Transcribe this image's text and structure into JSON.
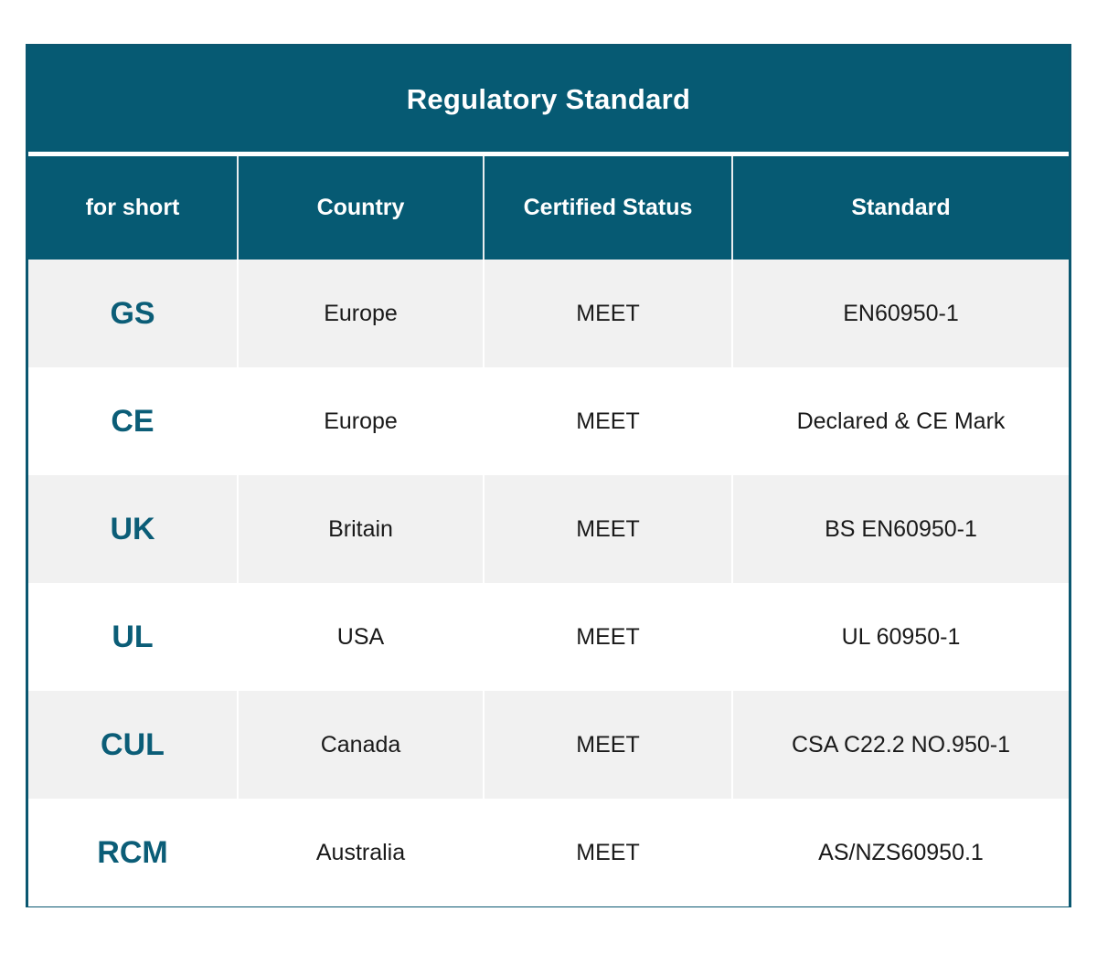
{
  "table": {
    "title": "Regulatory Standard",
    "columns": [
      {
        "key": "abbr",
        "label": "for short"
      },
      {
        "key": "country",
        "label": "Country"
      },
      {
        "key": "status",
        "label": "Certified Status"
      },
      {
        "key": "standard",
        "label": "Standard"
      }
    ],
    "rows": [
      {
        "abbr": "GS",
        "country": "Europe",
        "status": "MEET",
        "standard": "EN60950-1"
      },
      {
        "abbr": "CE",
        "country": "Europe",
        "status": "MEET",
        "standard": "Declared & CE Mark"
      },
      {
        "abbr": "UK",
        "country": "Britain",
        "status": "MEET",
        "standard": "BS EN60950-1"
      },
      {
        "abbr": "UL",
        "country": "USA",
        "status": "MEET",
        "standard": "UL 60950-1"
      },
      {
        "abbr": "CUL",
        "country": "Canada",
        "status": "MEET",
        "standard": "CSA C22.2 NO.950-1"
      },
      {
        "abbr": "RCM",
        "country": "Australia",
        "status": "MEET",
        "standard": "AS/NZS60950.1"
      }
    ]
  },
  "colors": {
    "header_background": "#065a73",
    "frame_border": "#0a5770",
    "abbreviation_text": "#0b5d77",
    "row_shade": "#f1f1f1",
    "row_plain": "#ffffff",
    "header_text": "#ffffff",
    "body_text": "#1a1a1a"
  }
}
